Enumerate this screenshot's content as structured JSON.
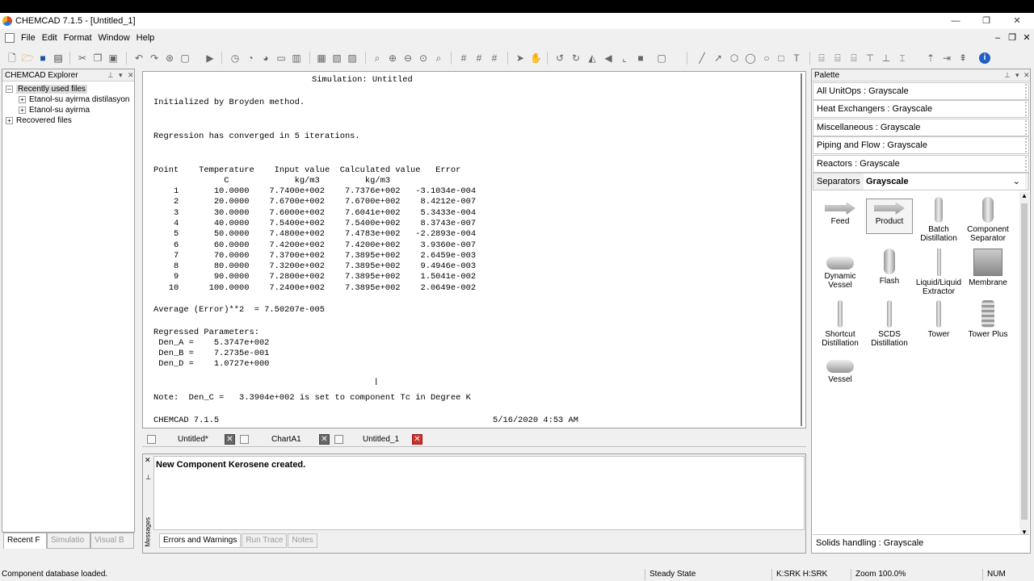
{
  "window": {
    "title": "CHEMCAD 7.1.5 - [Untitled_1]",
    "minimize": "—",
    "maximize": "❐",
    "close": "✕"
  },
  "menu": [
    "File",
    "Edit",
    "Format",
    "Window",
    "Help"
  ],
  "explorer": {
    "title": "CHEMCAD Explorer",
    "recent_label": "Recently used files",
    "files": [
      "Etanol-su ayirma distilasyon",
      "Etanol-su ayirma"
    ],
    "recovered_label": "Recovered files",
    "tabs": [
      "Recent F",
      "Simulatio",
      "Visual B"
    ]
  },
  "report": {
    "header": "Simulation: Untitled",
    "init": "Initialized by Broyden method.",
    "converged": "Regression has converged in 5 iterations.",
    "columns": "Point    Temperature    Input value  Calculated value   Error",
    "units": "              C             kg/m3         kg/m3",
    "rows": [
      "    1       10.0000    7.7400e+002    7.7376e+002   -3.1034e-004",
      "    2       20.0000    7.6700e+002    7.6700e+002    8.4212e-007",
      "    3       30.0000    7.6000e+002    7.6041e+002    5.3433e-004",
      "    4       40.0000    7.5400e+002    7.5400e+002    8.3743e-007",
      "    5       50.0000    7.4800e+002    7.4783e+002   -2.2893e-004",
      "    6       60.0000    7.4200e+002    7.4200e+002    3.9360e-007",
      "    7       70.0000    7.3700e+002    7.3895e+002    2.6459e-003",
      "    8       80.0000    7.3200e+002    7.3895e+002    9.4946e-003",
      "    9       90.0000    7.2800e+002    7.3895e+002    1.5041e-002",
      "   10      100.0000    7.2400e+002    7.3895e+002    2.0649e-002"
    ],
    "avg_error": "Average (Error)**2  = 7.50207e-005",
    "params_title": "Regressed Parameters:",
    "params": [
      " Den_A =    5.3747e+002",
      " Den_B =    7.2735e-001",
      " Den_D =    1.0727e+000"
    ],
    "note": "Note:  Den_C =   3.3904e+002 is set to component Tc in Degree K",
    "footer_left": "CHEMCAD 7.1.5",
    "footer_right": "5/16/2020 4:53 AM"
  },
  "doc_tabs": [
    "Untitled*",
    "ChartA1",
    "Untitled_1"
  ],
  "messages": {
    "text": "New Component Kerosene created.",
    "side_label": "Messages",
    "tabs": [
      "Errors and Warnings",
      "Run Trace",
      "Notes"
    ]
  },
  "palette": {
    "title": "Palette",
    "categories": [
      "All UnitOps : Grayscale",
      "Heat Exchangers : Grayscale",
      "Miscellaneous : Grayscale",
      "Piping and Flow : Grayscale",
      "Reactors : Grayscale"
    ],
    "selected_category": "Separators",
    "selected_value": "Grayscale",
    "items": [
      "Feed",
      "Product",
      "Batch Distillation",
      "Component Separator",
      "Dynamic Vessel",
      "Flash",
      "Liquid/Liquid Extractor",
      "Membrane",
      "Shortcut Distillation",
      "SCDS Distillation",
      "Tower",
      "Tower Plus",
      "Vessel"
    ],
    "solids": "Solids handling : Grayscale"
  },
  "status": {
    "left": "Component database loaded.",
    "mode": "Steady State",
    "thermo": "K:SRK H:SRK",
    "zoom": "Zoom 100.0%",
    "num": "NUM"
  }
}
